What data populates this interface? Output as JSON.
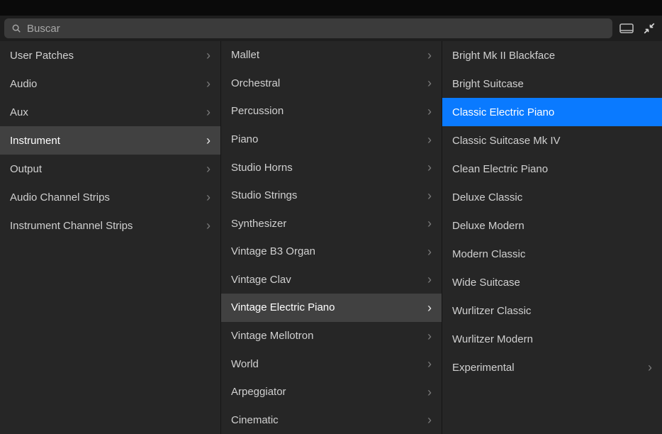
{
  "search": {
    "placeholder": "Buscar"
  },
  "col1": [
    {
      "label": "User Patches",
      "has_children": true
    },
    {
      "label": "Audio",
      "has_children": true
    },
    {
      "label": "Aux",
      "has_children": true
    },
    {
      "label": "Instrument",
      "has_children": true,
      "selected": true
    },
    {
      "label": "Output",
      "has_children": true
    },
    {
      "label": "Audio Channel Strips",
      "has_children": true
    },
    {
      "label": "Instrument Channel Strips",
      "has_children": true
    }
  ],
  "col2": [
    {
      "label": "Mallet",
      "has_children": true
    },
    {
      "label": "Orchestral",
      "has_children": true
    },
    {
      "label": "Percussion",
      "has_children": true
    },
    {
      "label": "Piano",
      "has_children": true
    },
    {
      "label": "Studio Horns",
      "has_children": true
    },
    {
      "label": "Studio Strings",
      "has_children": true
    },
    {
      "label": "Synthesizer",
      "has_children": true
    },
    {
      "label": "Vintage B3 Organ",
      "has_children": true
    },
    {
      "label": "Vintage Clav",
      "has_children": true
    },
    {
      "label": "Vintage Electric Piano",
      "has_children": true,
      "selected": true
    },
    {
      "label": "Vintage Mellotron",
      "has_children": true
    },
    {
      "label": "World",
      "has_children": true
    },
    {
      "label": "Arpeggiator",
      "has_children": true
    },
    {
      "label": "Cinematic",
      "has_children": true
    }
  ],
  "col3": [
    {
      "label": "Bright Mk II Blackface",
      "has_children": false
    },
    {
      "label": "Bright Suitcase",
      "has_children": false
    },
    {
      "label": "Classic Electric Piano",
      "has_children": false,
      "selected": true
    },
    {
      "label": "Classic Suitcase Mk IV",
      "has_children": false
    },
    {
      "label": "Clean Electric Piano",
      "has_children": false
    },
    {
      "label": "Deluxe Classic",
      "has_children": false
    },
    {
      "label": "Deluxe Modern",
      "has_children": false
    },
    {
      "label": "Modern Classic",
      "has_children": false
    },
    {
      "label": "Wide Suitcase",
      "has_children": false
    },
    {
      "label": "Wurlitzer Classic",
      "has_children": false
    },
    {
      "label": "Wurlitzer Modern",
      "has_children": false
    },
    {
      "label": "Experimental",
      "has_children": true
    }
  ]
}
